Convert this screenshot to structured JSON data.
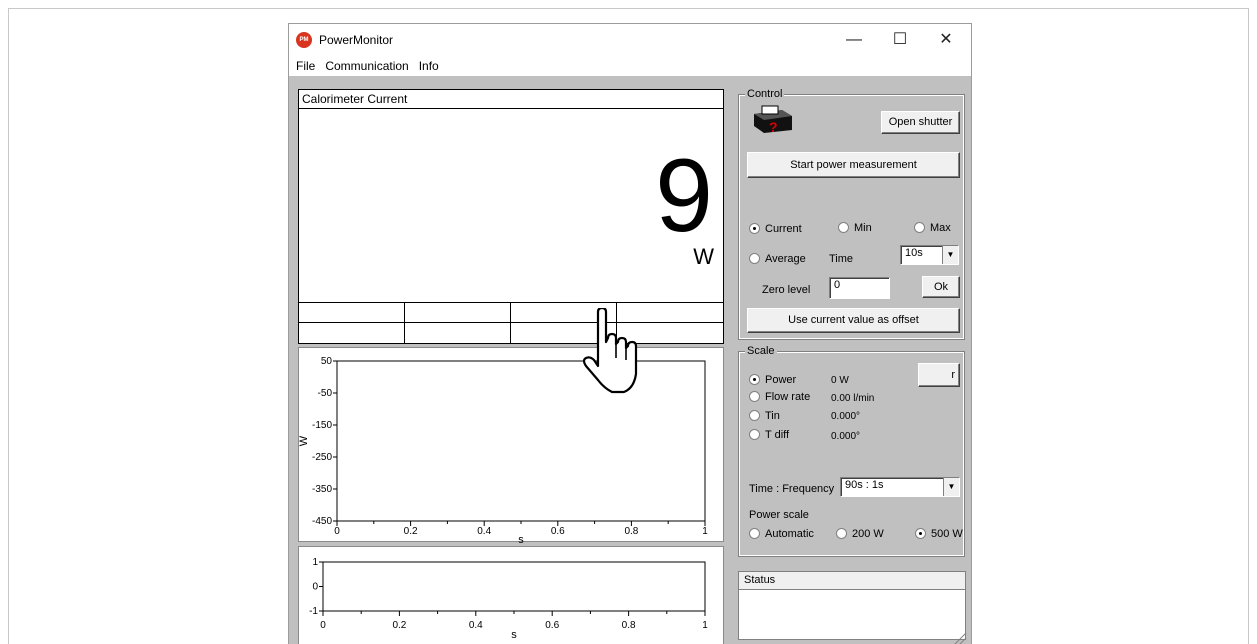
{
  "window": {
    "title": "PowerMonitor",
    "icon_text": "PM",
    "minimize_glyph": "—",
    "maximize_glyph": "☐",
    "close_glyph": "✕"
  },
  "menu": [
    "File",
    "Communication",
    "Info"
  ],
  "display": {
    "title": "Calorimeter Current",
    "value": "9",
    "unit": "W"
  },
  "chart_data": [
    {
      "type": "line",
      "ylabel": "W",
      "xlabel": "s",
      "ylim": [
        -450,
        50
      ],
      "xlim": [
        0,
        1
      ],
      "y_ticks": [
        "50",
        "-50",
        "-150",
        "-250",
        "-350",
        "-450"
      ],
      "x_ticks": [
        "0",
        "0.2",
        "0.4",
        "0.6",
        "0.8",
        "1"
      ],
      "series": []
    },
    {
      "type": "line",
      "xlabel": "s",
      "ylim": [
        -1,
        1
      ],
      "xlim": [
        0,
        1
      ],
      "y_ticks": [
        "1",
        "0",
        "-1"
      ],
      "x_ticks": [
        "0",
        "0.2",
        "0.4",
        "0.6",
        "0.8",
        "1"
      ],
      "series": []
    }
  ],
  "control": {
    "title": "Control",
    "open_shutter": "Open shutter",
    "start_measurement": "Start power measurement",
    "radio_current": "Current",
    "radio_min": "Min",
    "radio_max": "Max",
    "radio_average": "Average",
    "time_label": "Time",
    "time_value": "10s",
    "zero_level_label": "Zero level",
    "zero_level_value": "0",
    "ok": "Ok",
    "use_current_offset": "Use current value as offset"
  },
  "scale": {
    "title": "Scale",
    "items": [
      {
        "label": "Power",
        "value": "0 W",
        "selected": true
      },
      {
        "label": "Flow rate",
        "value": "0.00 l/min",
        "selected": false
      },
      {
        "label": "Tin",
        "value": "0.000°",
        "selected": false
      },
      {
        "label": "T diff",
        "value": "0.000°",
        "selected": false
      }
    ],
    "hidden_button_tail": "r",
    "time_frequency_label": "Time : Frequency",
    "time_frequency_value": "90s : 1s",
    "power_scale_label": "Power scale",
    "power_scale_options": [
      {
        "label": "Automatic",
        "selected": false
      },
      {
        "label": "200 W",
        "selected": false
      },
      {
        "label": "500 W",
        "selected": true
      }
    ]
  },
  "status": {
    "title": "Status"
  },
  "colors": {
    "client_bg": "#c0c0c0",
    "app_icon": "#d9341f"
  }
}
